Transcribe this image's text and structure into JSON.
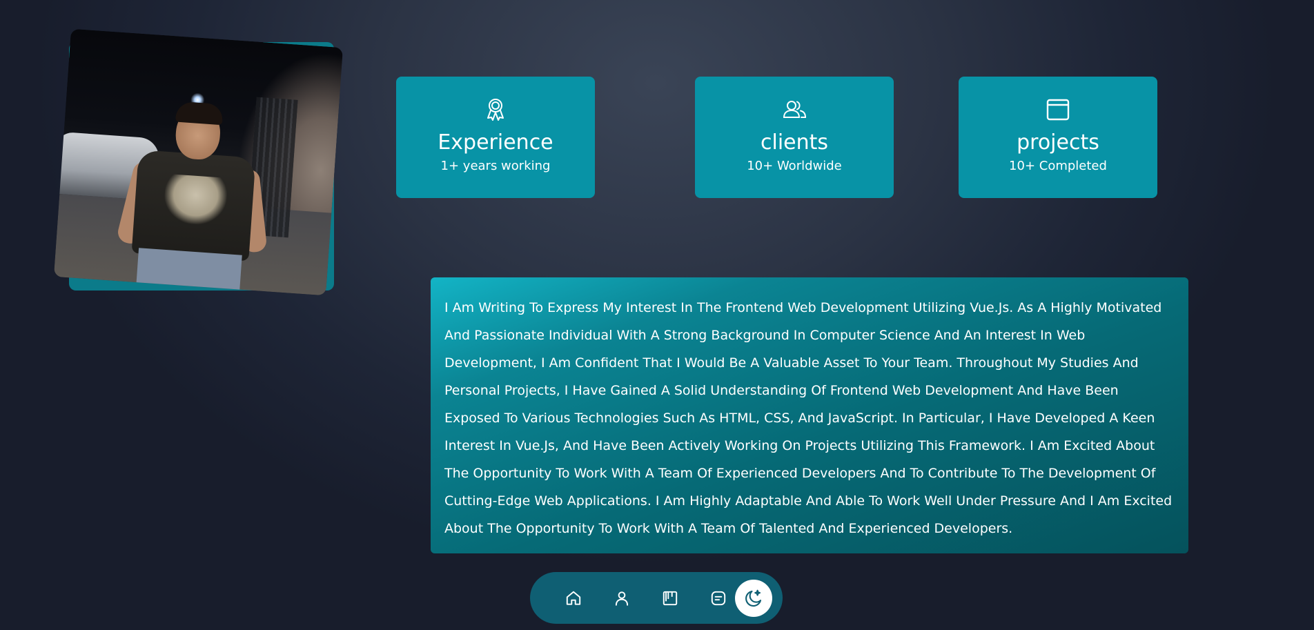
{
  "profile": {
    "photo_alt": "profile photo"
  },
  "stats": [
    {
      "icon": "award-icon",
      "title": "Experience",
      "subtitle": "1+ years working"
    },
    {
      "icon": "users-icon",
      "title": "clients",
      "subtitle": "10+ Worldwide"
    },
    {
      "icon": "window-icon",
      "title": "projects",
      "subtitle": "10+ Completed"
    }
  ],
  "about": {
    "text": "I Am Writing To Express My Interest In The Frontend Web Development Utilizing Vue.Js. As A Highly Motivated And Passionate Individual With A Strong Background In Computer Science And An Interest In Web Development, I Am Confident That I Would Be A Valuable Asset To Your Team. Throughout My Studies And Personal Projects, I Have Gained A Solid Understanding Of Frontend Web Development And Have Been Exposed To Various Technologies Such As HTML, CSS, And JavaScript. In Particular, I Have Developed A Keen Interest In Vue.Js, And Have Been Actively Working On Projects Utilizing This Framework. I Am Excited About The Opportunity To Work With A Team Of Experienced Developers And To Contribute To The Development Of Cutting-Edge Web Applications. I Am Highly Adaptable And Able To Work Well Under Pressure And I Am Excited About The Opportunity To Work With A Team Of Talented And Experienced Developers."
  },
  "nav": {
    "items": [
      "home-icon",
      "user-icon",
      "portfolio-icon",
      "message-icon",
      "moon-icon"
    ],
    "active": "moon-icon"
  },
  "colors": {
    "card": "#0893a6",
    "nav": "#0f5f73",
    "photo_backdrop": "#0b7b8a"
  }
}
